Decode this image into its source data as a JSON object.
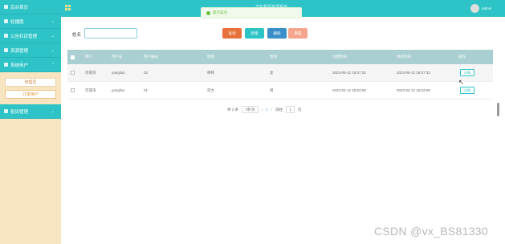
{
  "sidebar": {
    "items": [
      {
        "label": "后台首页",
        "icon": "home-icon"
      },
      {
        "label": "轮播图",
        "icon": "image-icon"
      },
      {
        "label": "公告栏目管理",
        "icon": "notice-icon"
      },
      {
        "label": "资源管理",
        "icon": "resource-icon"
      },
      {
        "label": "系统用户",
        "icon": "user-icon"
      }
    ],
    "sub_items": [
      {
        "label": "管理员"
      },
      {
        "label": "订单用户"
      }
    ],
    "last_item": {
      "label": "租赁管理",
      "icon": "rent-icon"
    }
  },
  "header": {
    "title": "汽车租赁管理系统",
    "user": "admin"
  },
  "toast": {
    "text": "提示成功"
  },
  "search": {
    "label": "姓名",
    "placeholder": ""
  },
  "buttons": {
    "query": "查询",
    "add": "新增",
    "delete": "删除",
    "reset": "重置"
  },
  "table": {
    "headers": [
      "用户",
      "用户名",
      "用户编号",
      "性别",
      "性别",
      "创建时间",
      "更新时间",
      "操作"
    ],
    "rows": [
      {
        "name": "可或浓",
        "username": "yangliu2",
        "number": "02",
        "role": "律师",
        "gender": "女",
        "created": "2023-05-12 15:07:33",
        "updated": "2023-05-12 15:07:33",
        "action": "详情"
      },
      {
        "name": "可或浓",
        "username": "yangliu1",
        "number": "01",
        "role": "司大",
        "gender": "男",
        "created": "2023-02-12 15:53:08",
        "updated": "2023-02-12 15:53:08",
        "action": "详情"
      }
    ]
  },
  "pagination": {
    "total": "共 2 条",
    "size": "7条/页",
    "prev": "‹",
    "page": "1",
    "next": "›",
    "goto": "前往",
    "goto_value": "1",
    "suffix": "页"
  },
  "watermark": "CSDN @vx_BS81330",
  "colors": {
    "primary": "#2ec4c7",
    "sidebar": "#f7e5c2",
    "query": "#e8703a",
    "add": "#2ec4c7",
    "delete": "#3a8fc8",
    "reset": "#f5a58e"
  }
}
